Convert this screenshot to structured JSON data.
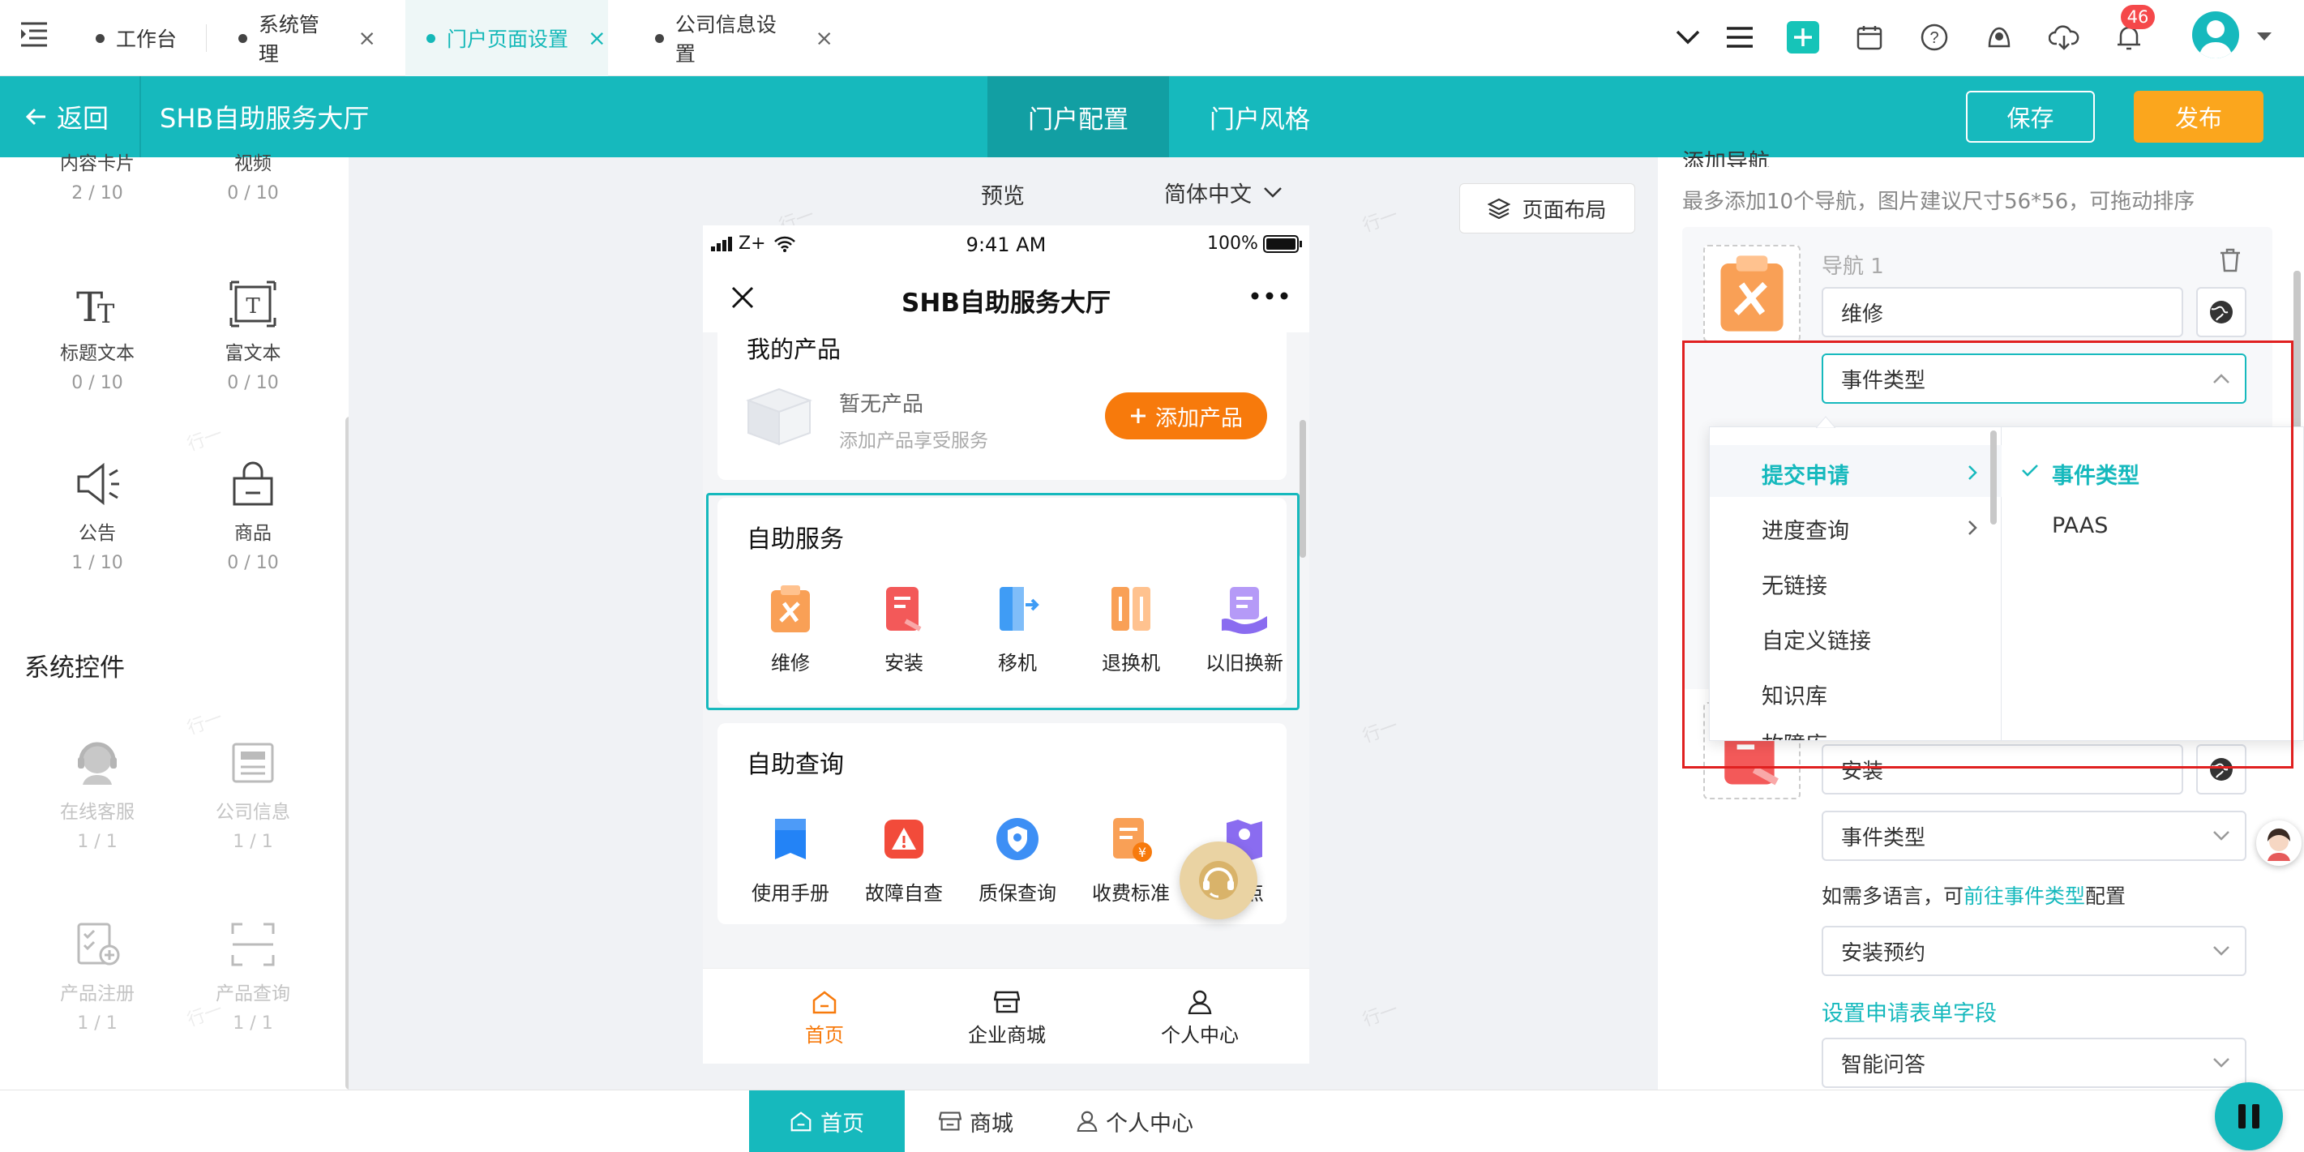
{
  "tabs": [
    {
      "label": "工作台",
      "closable": false
    },
    {
      "label": "系统管理",
      "closable": true
    },
    {
      "label": "门户页面设置",
      "closable": true,
      "active": true
    },
    {
      "label": "公司信息设置",
      "closable": true
    }
  ],
  "topbar": {
    "notification_count": "46",
    "icons": [
      "chevron-down-icon",
      "menu-icon",
      "plus-icon",
      "calendar-icon",
      "help-icon",
      "user-bell-icon",
      "cloud-download-icon",
      "bell-icon",
      "avatar"
    ]
  },
  "header": {
    "back_label": "返回",
    "title": "SHB自助服务大厅",
    "tabs": [
      "门户配置",
      "门户风格"
    ],
    "save_label": "保存",
    "publish_label": "发布"
  },
  "colors": {
    "primary": "#16b9bd",
    "orange": "#fba61d",
    "button_orange": "#f77a0c",
    "highlight_red": "#e02020"
  },
  "left": {
    "top_items": [
      {
        "label": "内容卡片",
        "count": "2 / 10"
      },
      {
        "label": "视频",
        "count": "0 / 10"
      }
    ],
    "items": [
      {
        "label": "标题文本",
        "count": "0 / 10",
        "icon": "title-text-icon"
      },
      {
        "label": "富文本",
        "count": "0 / 10",
        "icon": "rich-text-icon"
      },
      {
        "label": "公告",
        "count": "1 / 10",
        "icon": "speaker-icon"
      },
      {
        "label": "商品",
        "count": "0 / 10",
        "icon": "shopping-bag-icon"
      }
    ],
    "system_title": "系统控件",
    "system_items": [
      {
        "label": "在线客服",
        "count": "1 / 1",
        "icon": "customer-service-icon"
      },
      {
        "label": "公司信息",
        "count": "1 / 1",
        "icon": "company-info-icon"
      },
      {
        "label": "产品注册",
        "count": "1 / 1",
        "icon": "product-register-icon"
      },
      {
        "label": "产品查询",
        "count": "1 / 1",
        "icon": "product-scan-icon"
      }
    ]
  },
  "canvas": {
    "preview_label": "预览",
    "language": "简体中文",
    "layout_button": "页面布局",
    "watermark": "行一"
  },
  "phone": {
    "status": {
      "carrier": "Z+",
      "time": "9:41 AM",
      "battery": "100%"
    },
    "title": "SHB自助服务大厅",
    "my_products": {
      "title": "我的产品",
      "empty": "暂无产品",
      "hint": "添加产品享受服务",
      "add_button": "添加产品"
    },
    "self_service": {
      "title": "自助服务",
      "items": [
        "维修",
        "安装",
        "移机",
        "退换机",
        "以旧换新"
      ]
    },
    "self_query": {
      "title": "自助查询",
      "items": [
        "使用手册",
        "故障自查",
        "质保查询",
        "收费标准",
        "网点"
      ]
    },
    "nav": [
      "首页",
      "企业商城",
      "个人中心"
    ]
  },
  "right": {
    "section_title": "添加导航",
    "hint": "最多添加10个导航，图片建议尺寸56*56，可拖动排序",
    "nav1_label": "导航 1",
    "nav1_name": "维修",
    "nav1_type": "事件类型",
    "nav2_name": "安装",
    "nav2_type": "事件类型",
    "lang_hint": "如需多语言，可",
    "lang_link": "前往事件类型",
    "lang_suffix": "配置",
    "nav2_event": "安装预约",
    "form_link": "设置申请表单字段",
    "nav2_extra": "智能问答"
  },
  "dropdown": {
    "left_options": [
      "提交申请",
      "进度查询",
      "无链接",
      "自定义链接",
      "知识库",
      "故障库"
    ],
    "right_options": [
      "事件类型",
      "PAAS"
    ],
    "selected_left": "提交申请",
    "selected_right": "事件类型"
  },
  "bottombar": {
    "items": [
      "首页",
      "商城",
      "个人中心"
    ]
  }
}
